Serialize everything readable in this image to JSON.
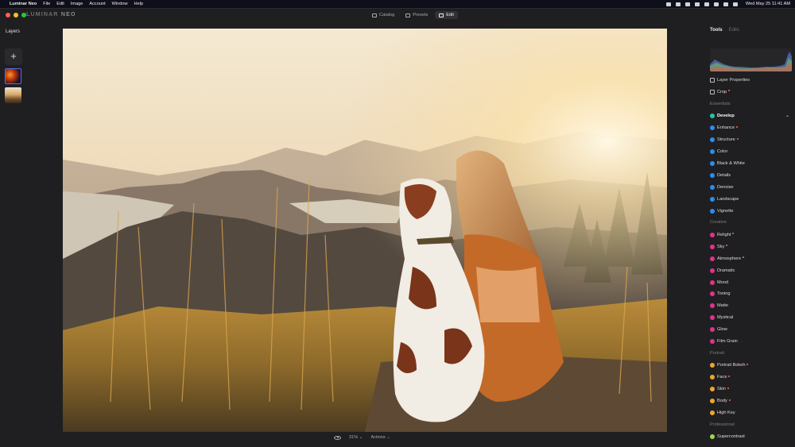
{
  "menubar": {
    "app_name": "Luminar Neo",
    "menus": [
      "File",
      "Edit",
      "Image",
      "Account",
      "Window",
      "Help"
    ],
    "datetime": "Wed May 25  11:41 AM"
  },
  "titlebar": {
    "logo": "LUMINAR",
    "logo_suffix": "NEO",
    "tabs": [
      {
        "label": "Catalog",
        "icon": "folder-icon"
      },
      {
        "label": "Presets",
        "icon": "presets-icon"
      },
      {
        "label": "Edit",
        "icon": "sliders-icon"
      }
    ],
    "active_tab": "Edit"
  },
  "layers": {
    "title": "Layers",
    "add_label": "+"
  },
  "bottombar": {
    "zoom": "31%",
    "zoom_caret": "⌄",
    "actions": "Actions",
    "actions_caret": "⌄"
  },
  "panel": {
    "tabs": [
      "Tools",
      "Edits"
    ],
    "active_tab": "Tools",
    "top_items": [
      {
        "label": "Layer Properties",
        "icon": "layers-icon"
      },
      {
        "label": "Crop",
        "icon": "crop-icon",
        "modified": true
      }
    ],
    "sections": [
      {
        "title": "Essentials",
        "items": [
          {
            "label": "Develop",
            "color": "#27c3a6",
            "active": true
          },
          {
            "label": "Enhance",
            "color": "#2d8cf0",
            "modified": true
          },
          {
            "label": "Structure",
            "color": "#2d8cf0",
            "modified": true
          },
          {
            "label": "Color",
            "color": "#2d8cf0"
          },
          {
            "label": "Black & White",
            "color": "#2d8cf0"
          },
          {
            "label": "Details",
            "color": "#2d8cf0"
          },
          {
            "label": "Denoise",
            "color": "#2d8cf0"
          },
          {
            "label": "Landscape",
            "color": "#2d8cf0"
          },
          {
            "label": "Vignette",
            "color": "#2d8cf0"
          }
        ]
      },
      {
        "title": "Creative",
        "items": [
          {
            "label": "Relight",
            "color": "#e0338a",
            "modified": true
          },
          {
            "label": "Sky",
            "color": "#e0338a",
            "modified": true
          },
          {
            "label": "Atmosphere",
            "color": "#e0338a",
            "modified": true
          },
          {
            "label": "Dramatic",
            "color": "#e0338a"
          },
          {
            "label": "Mood",
            "color": "#e0338a"
          },
          {
            "label": "Toning",
            "color": "#e0338a"
          },
          {
            "label": "Matte",
            "color": "#e0338a"
          },
          {
            "label": "Mystical",
            "color": "#e0338a"
          },
          {
            "label": "Glow",
            "color": "#e0338a"
          },
          {
            "label": "Film Grain",
            "color": "#e0338a"
          }
        ]
      },
      {
        "title": "Portrait",
        "items": [
          {
            "label": "Portrait Bokeh",
            "color": "#f0a52d",
            "modified": true
          },
          {
            "label": "Face",
            "color": "#f0a52d",
            "modified": true
          },
          {
            "label": "Skin",
            "color": "#f0a52d",
            "modified": true
          },
          {
            "label": "Body",
            "color": "#f0a52d",
            "modified": true
          },
          {
            "label": "High Key",
            "color": "#f0a52d"
          }
        ]
      },
      {
        "title": "Professional",
        "items": [
          {
            "label": "Supercontrast",
            "color": "#9bd84b"
          }
        ]
      }
    ]
  },
  "colors": {
    "accent_blue": "#5b6ee8",
    "modified_dot": "#ff6b3d",
    "panel_bg": "#1f1f21"
  }
}
